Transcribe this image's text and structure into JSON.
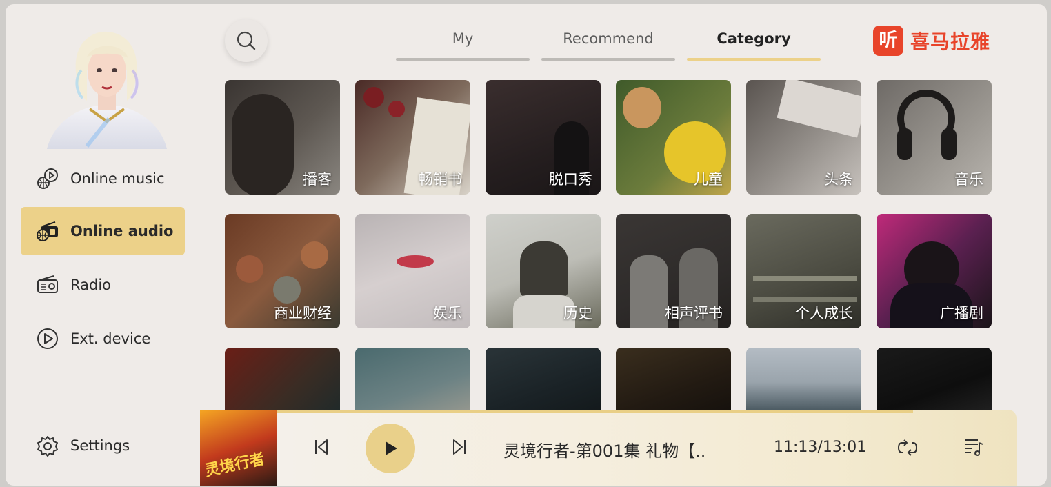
{
  "sidebar": {
    "items": [
      {
        "label": "Online music",
        "icon": "music-disc-icon",
        "active": false
      },
      {
        "label": "Online audio",
        "icon": "radio-globe-icon",
        "active": true
      },
      {
        "label": "Radio",
        "icon": "radio-icon",
        "active": false
      },
      {
        "label": "Ext. device",
        "icon": "play-circle-icon",
        "active": false
      }
    ],
    "settings_label": "Settings"
  },
  "header": {
    "tabs": [
      {
        "label": "My",
        "active": false
      },
      {
        "label": "Recommend",
        "active": false
      },
      {
        "label": "Category",
        "active": true
      }
    ],
    "brand": {
      "logo_glyph": "听",
      "name": "喜马拉雅"
    }
  },
  "categories": [
    "播客",
    "畅销书",
    "脱口秀",
    "儿童",
    "头条",
    "音乐",
    "商业财经",
    "娱乐",
    "历史",
    "相声评书",
    "个人成长",
    "广播剧",
    "",
    "",
    "",
    "",
    "",
    ""
  ],
  "player": {
    "track_title": "灵境行者-第001集 礼物【..",
    "time": "11:13/13:01",
    "progress": 0.86,
    "cover_text": "灵境行者"
  },
  "colors": {
    "accent": "#ecd189",
    "brand": "#e8442a",
    "background": "#efebe8"
  }
}
